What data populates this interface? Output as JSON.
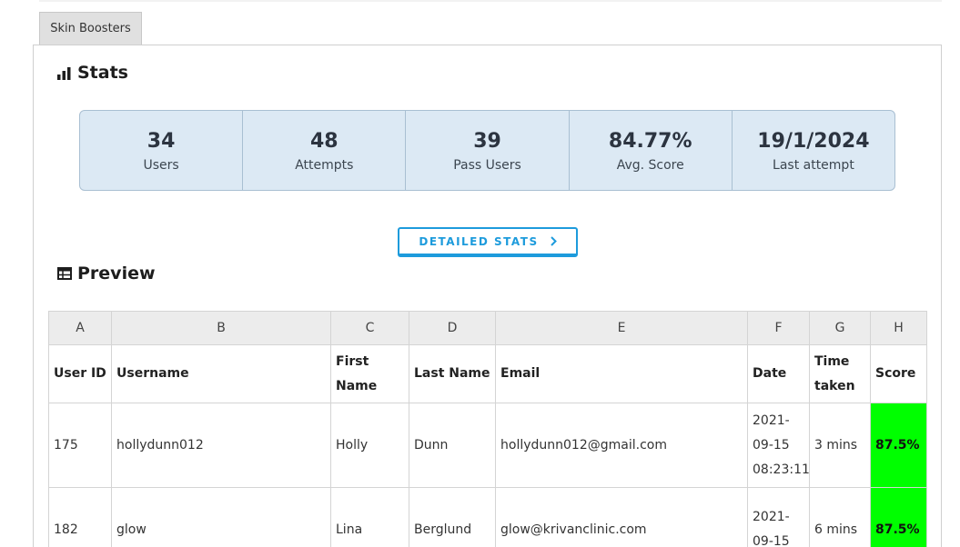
{
  "tab": {
    "label": "Skin Boosters"
  },
  "stats_section": {
    "title": "Stats",
    "items": [
      {
        "value": "34",
        "label": "Users"
      },
      {
        "value": "48",
        "label": "Attempts"
      },
      {
        "value": "39",
        "label": "Pass Users"
      },
      {
        "value": "84.77%",
        "label": "Avg. Score"
      },
      {
        "value": "19/1/2024",
        "label": "Last attempt"
      }
    ],
    "detailed_button": "DETAILED STATS"
  },
  "preview_section": {
    "title": "Preview",
    "column_letters": [
      "A",
      "B",
      "C",
      "D",
      "E",
      "F",
      "G",
      "H"
    ],
    "headers": [
      "User ID",
      "Username",
      "First Name",
      "Last Name",
      "Email",
      "Date",
      "Time taken",
      "Score"
    ],
    "rows": [
      {
        "user_id": "175",
        "username": "hollydunn012",
        "first_name": "Holly",
        "last_name": "Dunn",
        "email": "hollydunn012@gmail.com",
        "date": "2021-09-15 08:23:11",
        "time_taken": "3 mins",
        "score": "87.5%"
      },
      {
        "user_id": "182",
        "username": "glow",
        "first_name": "Lina",
        "last_name": "Berglund",
        "email": "glow@krivanclinic.com",
        "date": "2021-09-15",
        "time_taken": "6 mins",
        "score": "87.5%"
      }
    ]
  },
  "colors": {
    "stats_bg": "#dce9f4",
    "accent": "#1d9bdc",
    "score_pass": "#00ff00"
  },
  "icons": {
    "stats": "bar-chart-icon",
    "preview": "table-icon",
    "button": "chevron-right-icon"
  }
}
